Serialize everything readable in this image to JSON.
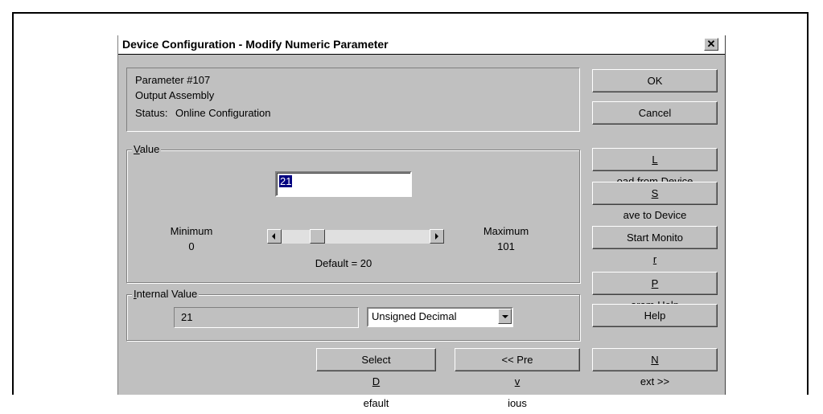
{
  "dialog": {
    "title": "Device Configuration - Modify Numeric Parameter",
    "close_glyph": "✕"
  },
  "info": {
    "parameter": "Parameter #107",
    "name": "Output Assembly",
    "status_label": "Status:",
    "status_value": "Online Configuration"
  },
  "value_group": {
    "label_underlined": "V",
    "label_rest": "alue",
    "input_value": "21",
    "minimum_label": "Minimum",
    "minimum_value": "0",
    "maximum_label": "Maximum",
    "maximum_value": "101",
    "default_text": "Default = 20",
    "slider_level": 0.21
  },
  "internal_group": {
    "label_underlined": "I",
    "label_rest": "nternal Value",
    "value": "21",
    "format_selected": "Unsigned Decimal"
  },
  "buttons": {
    "ok": "OK",
    "cancel": "Cancel",
    "load_u": "L",
    "load_rest": "oad from Device",
    "save_u": "S",
    "save_rest": "ave to Device",
    "monitor_pre": "Start Monito",
    "monitor_u": "r",
    "param_u": "P",
    "param_rest": "aram Help",
    "help": "Help",
    "select_pre": "Select ",
    "select_u": "D",
    "select_rest": "efault",
    "prev_pre": "<< Pre",
    "prev_u": "v",
    "prev_rest": "ious",
    "next_u": "N",
    "next_rest": "ext >>"
  }
}
